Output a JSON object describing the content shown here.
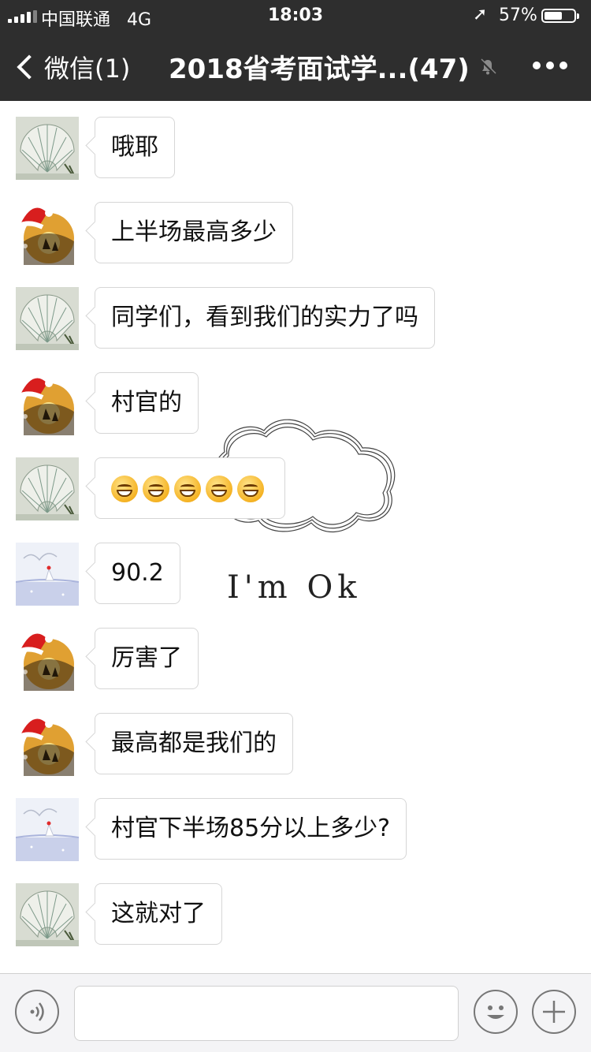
{
  "status_bar": {
    "carrier": "中国联通",
    "network": "4G",
    "time": "18:03",
    "battery": "57%",
    "battery_level": 0.57
  },
  "nav": {
    "back_label": "微信(1)",
    "title": "2018省考面试学...(47)"
  },
  "sticker": {
    "text": "I'm Ok"
  },
  "messages": [
    {
      "sender": "fan",
      "text": "哦耶"
    },
    {
      "sender": "santa",
      "text": "上半场最高多少"
    },
    {
      "sender": "fan",
      "text": "同学们，看到我们的实力了吗"
    },
    {
      "sender": "santa",
      "text": "村官的"
    },
    {
      "sender": "fan",
      "text": "",
      "emoji_count": 5
    },
    {
      "sender": "snow",
      "text": "90.2"
    },
    {
      "sender": "santa",
      "text": "厉害了"
    },
    {
      "sender": "santa",
      "text": "最高都是我们的"
    },
    {
      "sender": "snow",
      "text": "村官下半场85分以上多少?"
    },
    {
      "sender": "fan",
      "text": "这就对了"
    }
  ],
  "input": {
    "placeholder": ""
  },
  "colors": {
    "nav_bg": "#2e2e2e",
    "chat_bg": "#ffffff",
    "bubble_bg": "#ffffff",
    "input_bar_bg": "#f4f4f6"
  }
}
